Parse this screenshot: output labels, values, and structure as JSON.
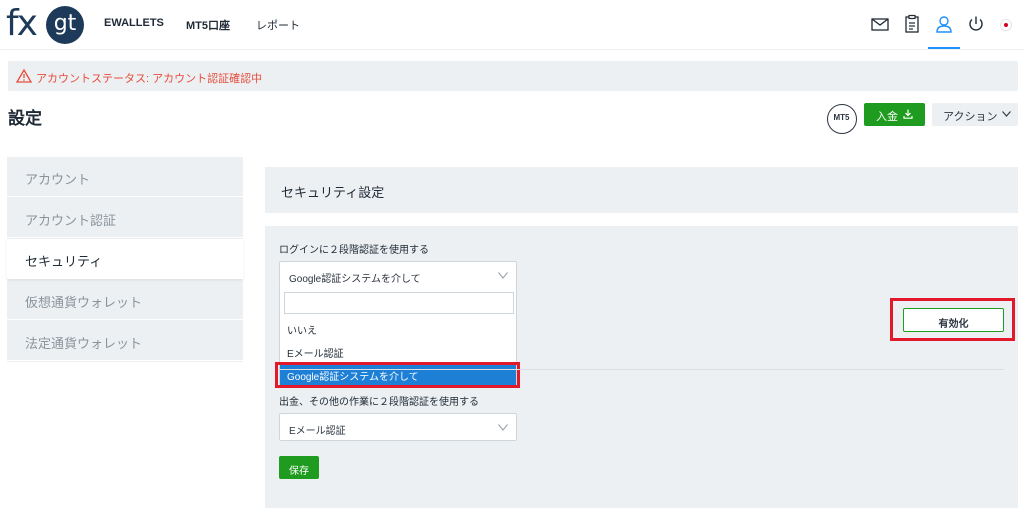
{
  "header": {
    "logo_fx": "fx",
    "logo_gt": "gt",
    "nav": [
      "EWALLETS",
      "MT5口座",
      "レポート"
    ],
    "icons": [
      "mail-icon",
      "clipboard-icon",
      "user-icon",
      "power-icon",
      "japan-flag-icon"
    ]
  },
  "alert": {
    "text": "アカウントステータス: アカウント認証確認中",
    "color": "#e74c3c"
  },
  "page": {
    "title": "設定",
    "mt5_badge": "MT5",
    "deposit_label": "入金",
    "action_label": "アクション"
  },
  "sidebar": {
    "items": [
      {
        "label": "アカウント",
        "active": false
      },
      {
        "label": "アカウント認証",
        "active": false
      },
      {
        "label": "セキュリティ",
        "active": true
      },
      {
        "label": "仮想通貨ウォレット",
        "active": false
      },
      {
        "label": "法定通貨ウォレット",
        "active": false
      }
    ]
  },
  "security": {
    "section_title": "セキュリティ設定",
    "login_2fa_label": "ログインに２段階認証を使用する",
    "login_2fa_value": "Google認証システムを介して",
    "options": [
      "いいえ",
      "Eメール認証",
      "Google認証システムを介して"
    ],
    "enable_label": "有効化",
    "withdraw_2fa_label": "出金、その他の作業に２段階認証を使用する",
    "withdraw_2fa_value": "Eメール認証",
    "save_label": "保存"
  },
  "colors": {
    "brand": "#1e3a5a",
    "green": "#1f9c1f",
    "highlight": "#e1192b",
    "selected": "#1e7fd6"
  }
}
